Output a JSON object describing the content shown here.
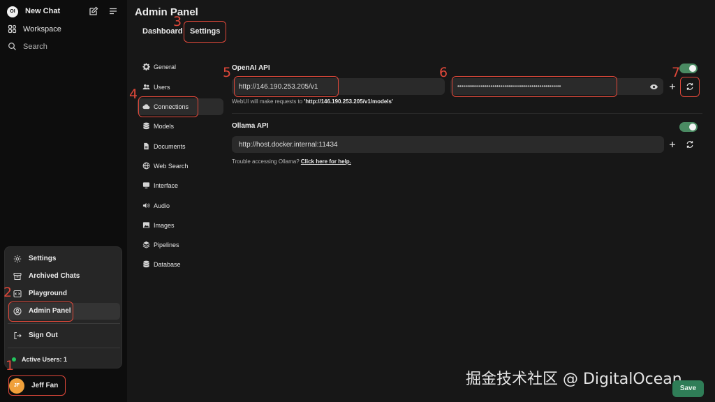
{
  "sidebar": {
    "logo_text": "OI",
    "new_chat_label": "New Chat",
    "items": [
      {
        "label": "Workspace",
        "icon": "workspace-grid-icon"
      },
      {
        "label": "Search",
        "icon": "search-icon"
      }
    ]
  },
  "user_menu": {
    "items": [
      {
        "label": "Settings",
        "icon": "gear-icon"
      },
      {
        "label": "Archived Chats",
        "icon": "archive-icon"
      },
      {
        "label": "Playground",
        "icon": "code-icon"
      },
      {
        "label": "Admin Panel",
        "icon": "user-circle-icon"
      },
      {
        "label": "Sign Out",
        "icon": "sign-out-icon"
      }
    ],
    "active_users": "Active Users: 1"
  },
  "user": {
    "initials": "JF",
    "name": "Jeff Fan"
  },
  "main": {
    "title": "Admin Panel",
    "tabs": [
      {
        "label": "Dashboard"
      },
      {
        "label": "Settings"
      }
    ]
  },
  "settings_nav": [
    {
      "label": "General",
      "icon": "gear-icon"
    },
    {
      "label": "Users",
      "icon": "users-icon"
    },
    {
      "label": "Connections",
      "icon": "cloud-icon"
    },
    {
      "label": "Models",
      "icon": "database-icon"
    },
    {
      "label": "Documents",
      "icon": "document-icon"
    },
    {
      "label": "Web Search",
      "icon": "globe-icon"
    },
    {
      "label": "Interface",
      "icon": "monitor-icon"
    },
    {
      "label": "Audio",
      "icon": "speaker-icon"
    },
    {
      "label": "Images",
      "icon": "image-icon"
    },
    {
      "label": "Pipelines",
      "icon": "layers-icon"
    },
    {
      "label": "Database",
      "icon": "database-icon"
    }
  ],
  "openai": {
    "label": "OpenAI API",
    "url": "http://146.190.253.205/v1",
    "api_key_masked": "•••••••••••••••••••••••••••••••••••••••••••••••••••••",
    "help_prefix": "WebUI will make requests to",
    "help_url": "'http://146.190.253.205/v1/models'",
    "enabled": true
  },
  "ollama": {
    "label": "Ollama API",
    "url": "http://host.docker.internal:11434",
    "help_prefix": "Trouble accessing Ollama?",
    "help_link": "Click here for help.",
    "enabled": true
  },
  "save_label": "Save",
  "watermark": "掘金技术社区 @ DigitalOcean",
  "annotations": [
    "1",
    "2",
    "3",
    "4",
    "5",
    "6",
    "7"
  ],
  "colors": {
    "accent_green": "#2f7d57",
    "toggle_on": "#4a8a62",
    "annotation_red": "#e0483a",
    "status_green": "#22c55e"
  }
}
